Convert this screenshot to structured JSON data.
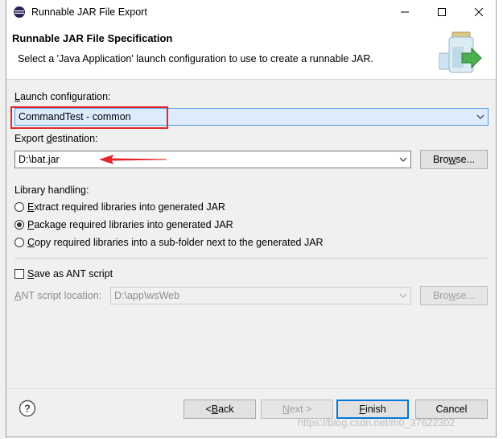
{
  "window": {
    "title": "Runnable JAR File Export"
  },
  "header": {
    "title": "Runnable JAR File Specification",
    "message": "Select a 'Java Application' launch configuration to use to create a runnable JAR."
  },
  "launch": {
    "label_pre": "",
    "label_key": "L",
    "label_post": "aunch configuration:",
    "value": "CommandTest - common"
  },
  "export": {
    "label_pre": "Export ",
    "label_key": "d",
    "label_post": "estination:",
    "value": "D:\\bat.jar",
    "browse_pre": "Bro",
    "browse_key": "w",
    "browse_post": "se..."
  },
  "library": {
    "label": "Library handling:",
    "options": [
      {
        "key": "E",
        "rest": "xtract required libraries into generated JAR",
        "checked": false
      },
      {
        "key": "P",
        "rest": "ackage required libraries into generated JAR",
        "checked": true
      },
      {
        "key": "C",
        "rest": "opy required libraries into a sub-folder next to the generated JAR",
        "checked": false
      }
    ]
  },
  "ant": {
    "checkbox_key": "S",
    "checkbox_rest": "ave as ANT script",
    "location_key": "A",
    "location_rest": "NT script location:",
    "location_value": "D:\\app\\wsWeb",
    "browse_pre": "Bro",
    "browse_key": "w",
    "browse_post": "se..."
  },
  "footer": {
    "back_pre": "< ",
    "back_key": "B",
    "back_post": "ack",
    "next_key": "N",
    "next_post": "ext >",
    "finish_key": "F",
    "finish_post": "inish",
    "cancel": "Cancel"
  },
  "watermark": "https://blog.csdn.net/m0_37622302",
  "colors": {
    "highlight_box": "#e5262b",
    "arrow": "#e5262b",
    "default_button": "#0078d7"
  }
}
